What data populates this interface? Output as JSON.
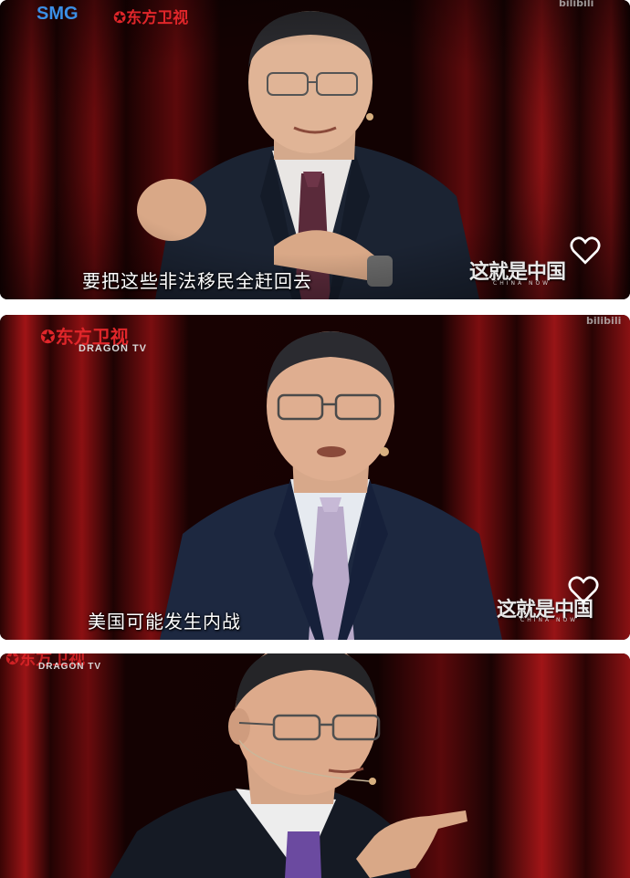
{
  "panels": [
    {
      "subtitle": "要把这些非法移民全赶回去",
      "logos": {
        "smg": "SMG",
        "dragon_tv": "东方卫视"
      },
      "show": {
        "title": "这就是中国",
        "subtitle": "CHINA NOW"
      },
      "watermark": "bilibili"
    },
    {
      "subtitle": "美国可能发生内战",
      "logos": {
        "dragon_tv": "东方卫视",
        "dragon_tv_en": "DRAGON TV"
      },
      "show": {
        "title": "这就是中国",
        "subtitle": "CHINA NOW"
      },
      "watermark": "bilibili"
    },
    {
      "logos": {
        "dragon_tv": "东方卫视",
        "dragon_tv_en": "DRAGON TV"
      }
    }
  ],
  "colors": {
    "curtain": "#6e0b0c",
    "curtain_dark": "#1a0303",
    "suit": "#1c2536",
    "tie1": "#5a2a3a",
    "tie2": "#b8a9c9",
    "tie3": "#6b4aa0",
    "brand_blue": "#3b8fe6",
    "brand_red": "#e0262a"
  }
}
